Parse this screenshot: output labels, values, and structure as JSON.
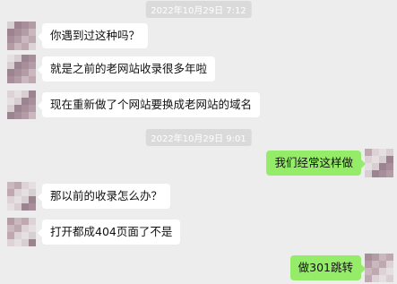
{
  "timestamps": [
    "2022年10月29日 7:12",
    "2022年10月29日 9:01"
  ],
  "messages": [
    {
      "side": "left",
      "text": "你遇到过这种吗？"
    },
    {
      "side": "left",
      "text": "就是之前的老网站收录很多年啦"
    },
    {
      "side": "left",
      "text": "现在重新做了个网站要换成老网站的域名"
    },
    {
      "side": "right",
      "text": "我们经常这样做"
    },
    {
      "side": "left",
      "text": "那以前的收录怎么办？"
    },
    {
      "side": "left",
      "text": "打开都成404页面了不是"
    },
    {
      "side": "right",
      "text": "做301跳转"
    }
  ],
  "colors": {
    "background": "#ededed",
    "incoming_bubble": "#ffffff",
    "outgoing_bubble": "#95ec69",
    "timestamp_bg": "#dadada"
  }
}
